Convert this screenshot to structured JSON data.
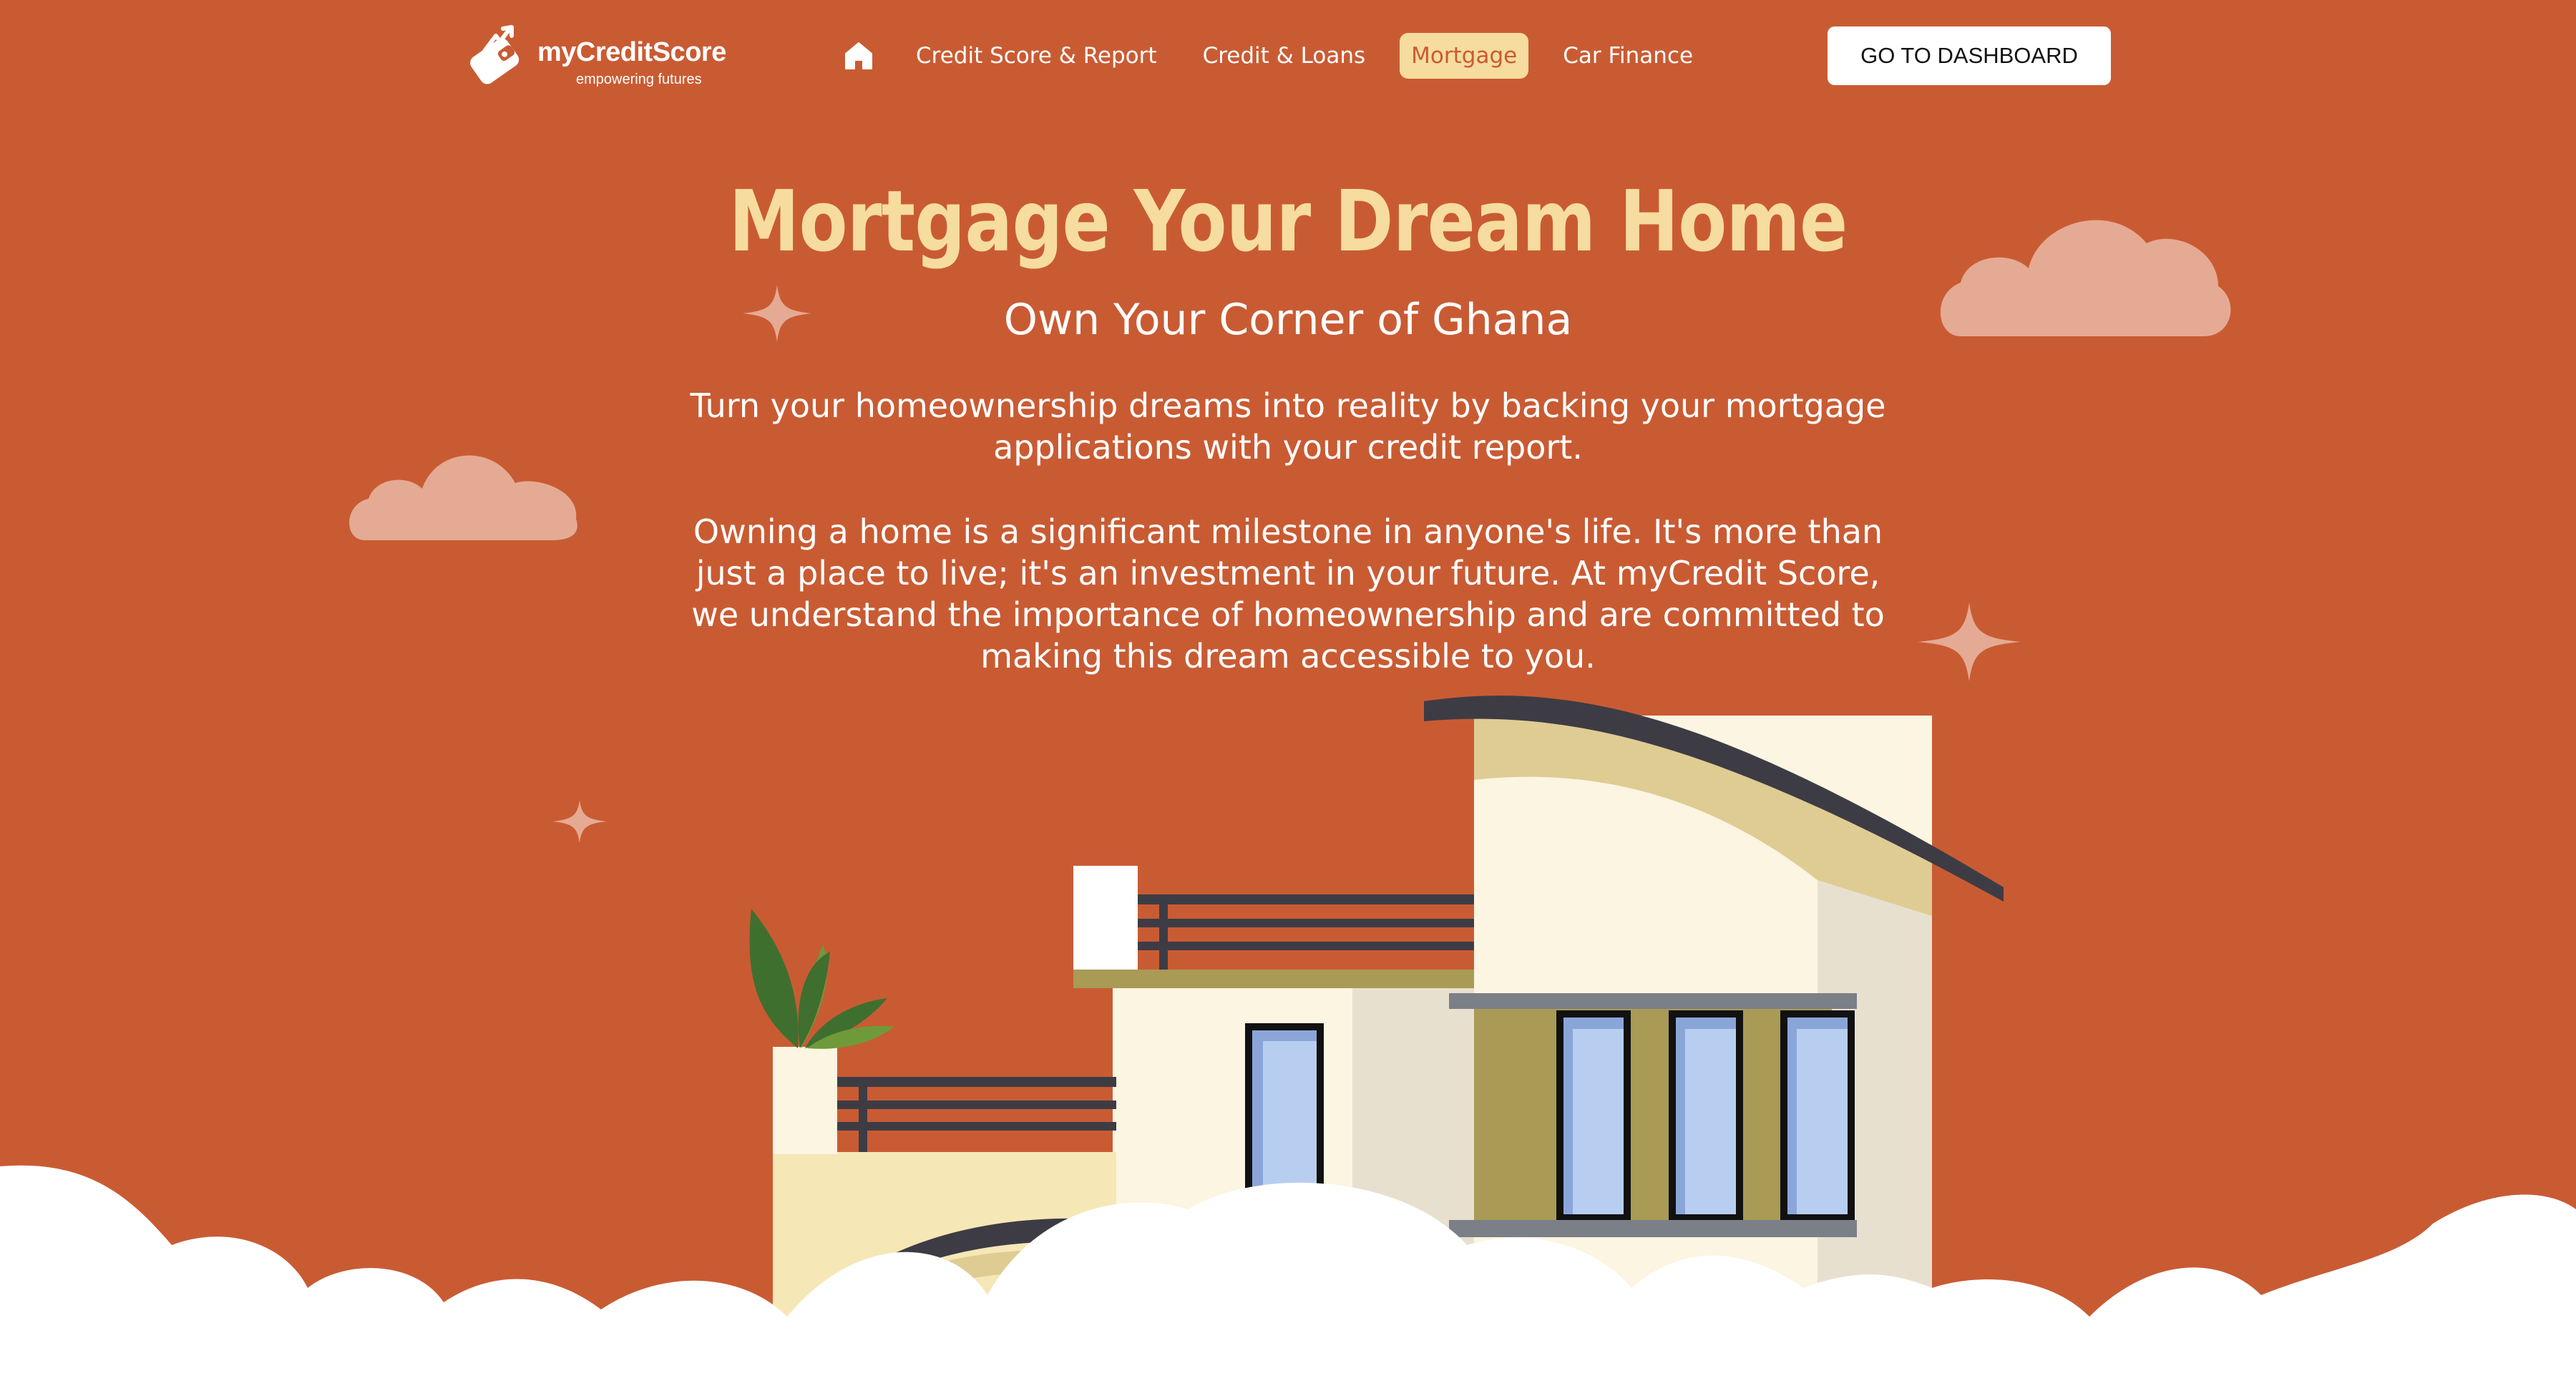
{
  "brand": {
    "name": "myCreditScore",
    "tagline": "empowering futures"
  },
  "nav": {
    "home_icon": "home-icon",
    "items": [
      {
        "label": "Credit Score & Report",
        "active": false
      },
      {
        "label": "Credit & Loans",
        "active": false
      },
      {
        "label": "Mortgage",
        "active": true
      },
      {
        "label": "Car Finance",
        "active": false
      }
    ],
    "cta_label": "GO TO DASHBOARD"
  },
  "hero": {
    "title": "Mortgage Your Dream Home",
    "subtitle": "Own Your Corner of Ghana",
    "paragraph_1": "Turn your homeownership dreams into reality by backing your mortgage applications with your credit report.",
    "paragraph_2": "Owning a home is a significant milestone in anyone's life. It's more than just a place to live; it's an investment in your future. At myCredit Score, we understand the importance of homeownership and are committed to making this dream accessible to you."
  },
  "colors": {
    "background": "#c95b33",
    "accent": "#f6dc9f",
    "cloud_pink": "#e5aa93",
    "white": "#ffffff"
  }
}
